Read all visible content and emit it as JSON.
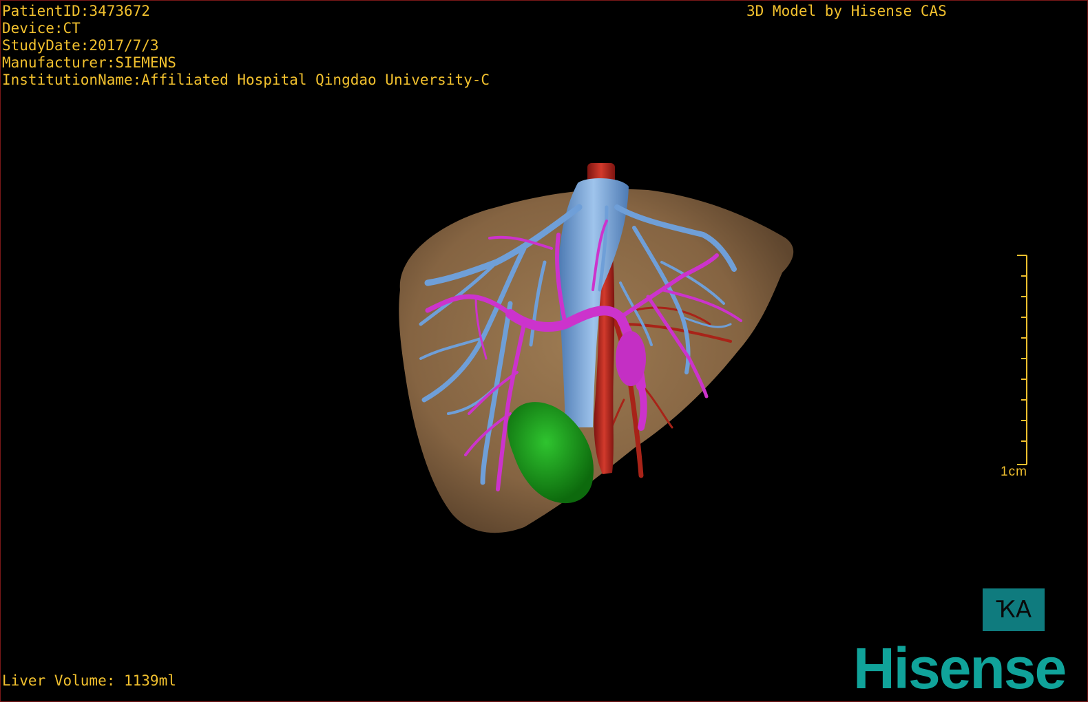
{
  "overlay": {
    "patient_id": "PatientID:3473672",
    "device": "Device:CT",
    "study_date": "StudyDate:2017/7/3",
    "manufacturer": "Manufacturer:SIEMENS",
    "institution": "InstitutionName:Affiliated Hospital Qingdao University-C",
    "credit": "3D Model by Hisense CAS",
    "liver_volume": "Liver Volume: 1139ml"
  },
  "scale": {
    "label": "1cm"
  },
  "orientation": {
    "label": "ҠA"
  },
  "brand": {
    "name": "Hisense"
  },
  "colors": {
    "text": "#f2c12e",
    "liver": "#8a6a45",
    "portal_vein": "#cc33cc",
    "hepatic_vein": "#6f9fd8",
    "artery": "#b0261e",
    "lesion": "#1c9a1c",
    "brand": "#10a39a",
    "orient_button": "#0f7b7e"
  },
  "icons": {
    "orientation": "orientation-cube-icon",
    "scale": "scale-ruler-icon"
  }
}
